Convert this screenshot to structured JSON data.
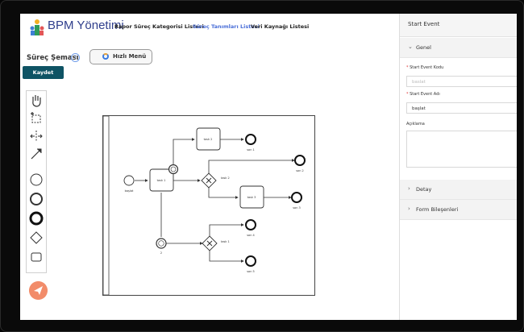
{
  "header": {
    "brand": "BPM Yönetimi",
    "nav": [
      {
        "label": "Rapor",
        "active": false
      },
      {
        "label": "Süreç Kategorisi Listesi",
        "active": false
      },
      {
        "label": "Süreç Tanımları Listesi",
        "active": true
      },
      {
        "label": "Veri Kaynağı Listesi",
        "active": false
      }
    ]
  },
  "left": {
    "title": "Süreç Şeması",
    "info_glyph": "?",
    "quick_menu_label": "Hızlı Menü",
    "save_label": "Kaydet"
  },
  "palette": {
    "tools": [
      {
        "name": "hand-tool-icon"
      },
      {
        "name": "lasso-tool-icon"
      },
      {
        "name": "space-tool-icon"
      },
      {
        "name": "connect-tool-icon"
      },
      {
        "name": "start-event-icon"
      },
      {
        "name": "intermediate-event-icon"
      },
      {
        "name": "end-event-icon"
      },
      {
        "name": "gateway-icon"
      },
      {
        "name": "task-icon"
      }
    ]
  },
  "diagram": {
    "start_label": "başlat",
    "task1_label": "task 1",
    "task2_label": "task 2",
    "task3_label": "task 3",
    "timer_label": "",
    "gw1_label": "task 2",
    "gw2_label": "task 1",
    "end_labels": [
      "son 1",
      "son 2",
      "son 3",
      "son 4",
      "son 5"
    ],
    "bottom_timer_label": "2"
  },
  "panel": {
    "title": "Start Event",
    "genel_label": "Genel",
    "kod_label": "Start Event Kodu",
    "kod_placeholder": "baslat",
    "ad_label": "Start Event Adı",
    "ad_value": "başlat",
    "aciklama_label": "Açıklama",
    "detay_label": "Detay",
    "form_label": "Form Bileşenleri"
  },
  "colors": {
    "brand": "#2f3e8c",
    "active_nav": "#4b6fd8",
    "save": "#0e5364",
    "send": "#f28c6a"
  }
}
